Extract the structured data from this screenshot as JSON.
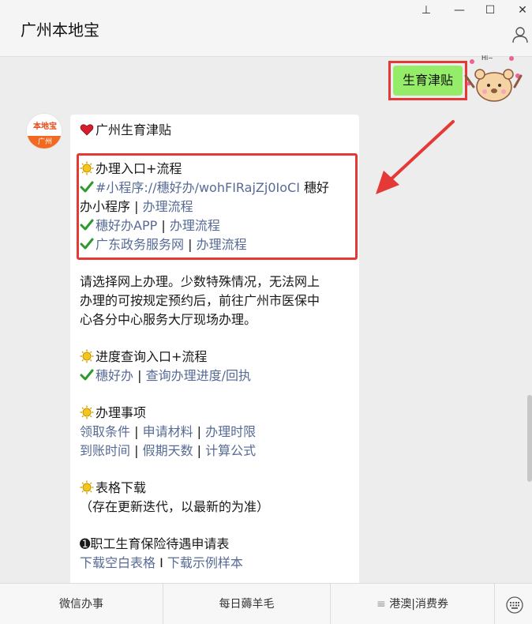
{
  "window": {
    "title": "广州本地宝",
    "minimize": "—",
    "maximize": "☐",
    "close": "✕",
    "pin": "⊥"
  },
  "sent_message": {
    "text": "生育津贴"
  },
  "bot": {
    "avatar_top": "本地宝",
    "avatar_bottom": "广州"
  },
  "message": {
    "heading": "广州生育津贴",
    "section1_title": "办理入口+流程",
    "item1_link": "#小程序://穗好办/wohFIRajZj0IoCI",
    "item1_suffix": " 穗好",
    "item1_line2_prefix": "办小程序 | ",
    "item1_line2_link": "办理流程",
    "item2_link": "穗好办APP",
    "item2_sep": " | ",
    "item2_link2": "办理流程",
    "item3_link": "广东政务服务网",
    "item3_sep": " | ",
    "item3_link2": "办理流程",
    "para1_line1": "请选择网上办理。少数特殊情况，无法网上",
    "para1_line2": "办理的可按规定预约后，前往广州市医保中",
    "para1_line3": "心各分中心服务大厅现场办理。",
    "section2_title": "进度查询入口+流程",
    "progress_link": "穗好办",
    "progress_sep": " | ",
    "progress_link2": "查询办理进度/回执",
    "section3_title": "办理事项",
    "matter_a": "领取条件",
    "matter_b": "申请材料",
    "matter_c": "办理时限",
    "matter_d": "到账时间",
    "matter_e": "假期天数",
    "matter_f": "计算公式",
    "sep": " | ",
    "section4_title": "表格下载",
    "section4_note": "（存在更新迭代，以最新的为准）",
    "form_title": "➊职工生育保险待遇申请表",
    "download_blank": "下载空白表格",
    "download_sep": " I ",
    "download_sample": "下载示例样本"
  },
  "bottom_menu": [
    {
      "label": "微信办事"
    },
    {
      "label": "每日薅羊毛"
    },
    {
      "label": "港澳|消费券",
      "prefix": "≡ "
    }
  ],
  "colors": {
    "accent_green": "#95ec69",
    "link": "#576b95",
    "highlight_red": "#e53935"
  }
}
